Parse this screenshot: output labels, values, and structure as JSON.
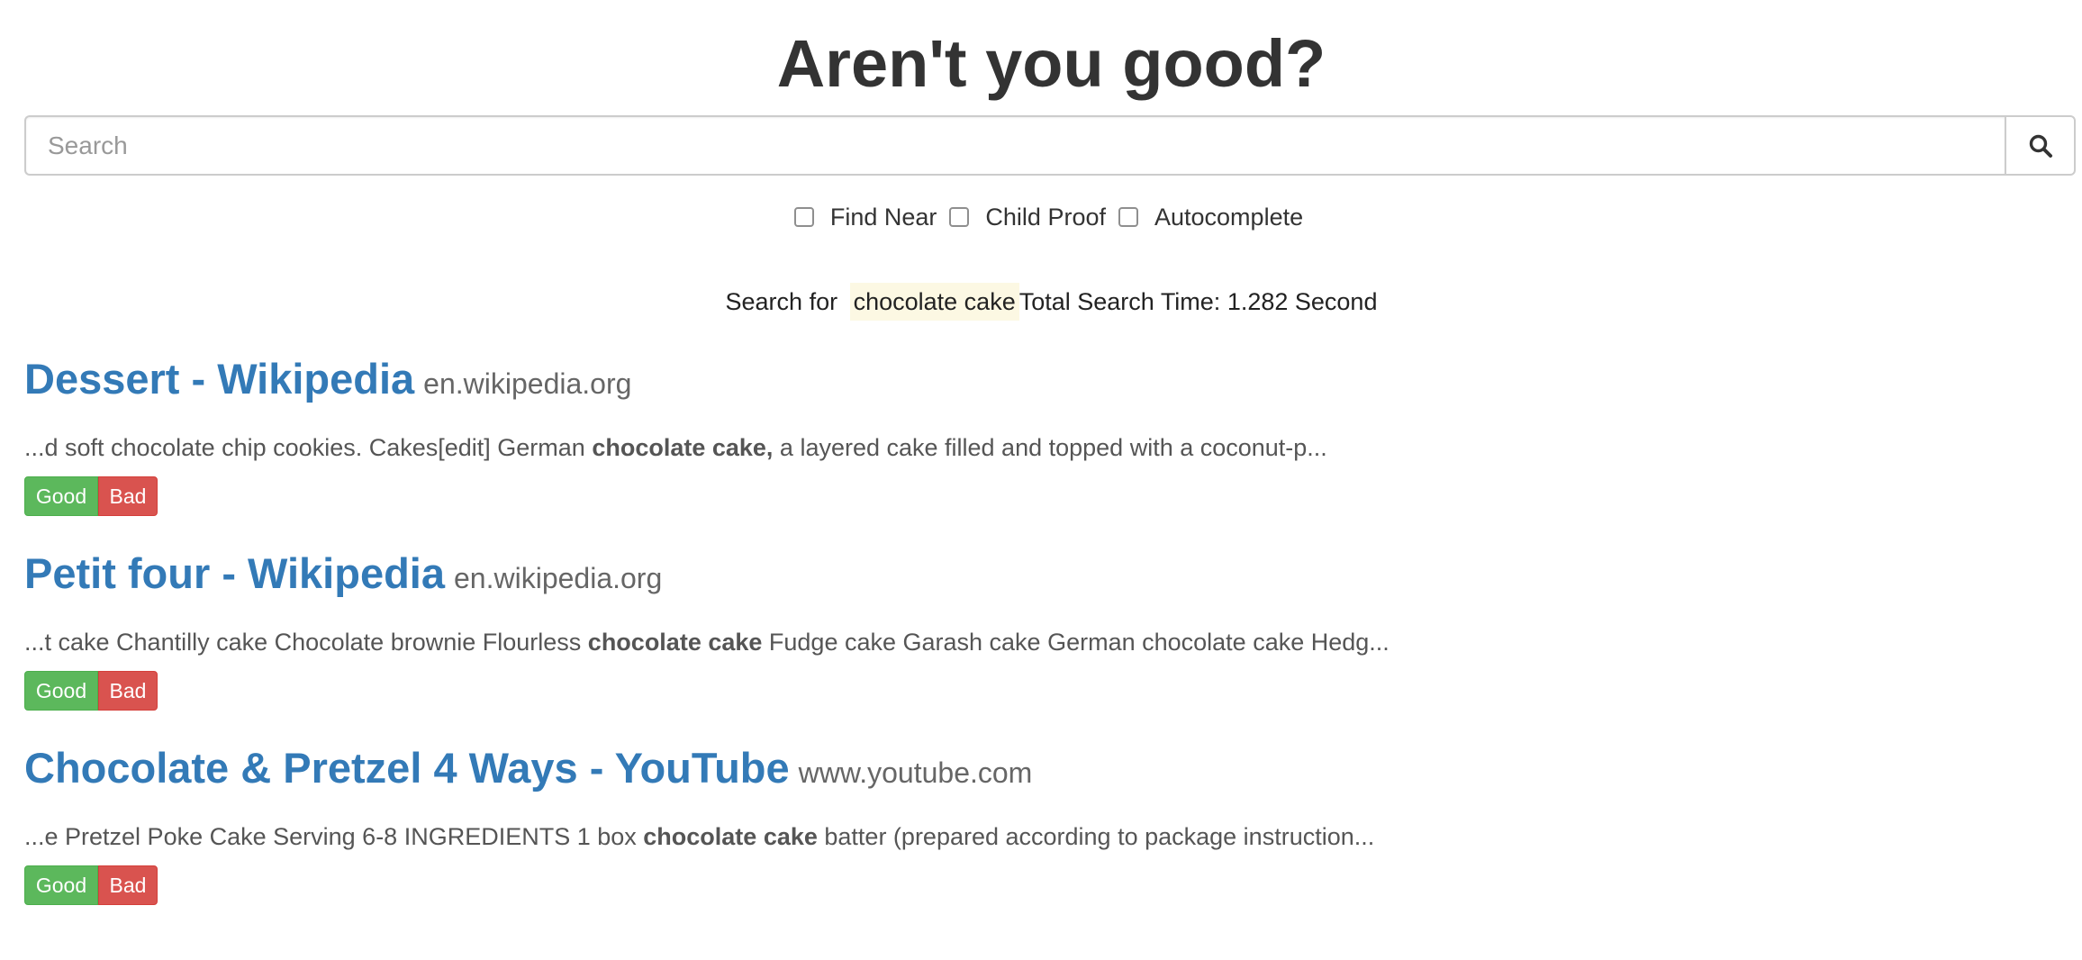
{
  "header": {
    "title": "Aren't you good?"
  },
  "search": {
    "placeholder": "Search",
    "value": "",
    "button_icon": "search-icon"
  },
  "options": [
    {
      "label": "Find Near",
      "checked": false
    },
    {
      "label": "Child Proof",
      "checked": false
    },
    {
      "label": "Autocomplete",
      "checked": false
    }
  ],
  "summary": {
    "prefix": "Search for",
    "query": "chocolate cake",
    "time_text": "Total Search Time: 1.282 Second"
  },
  "results": [
    {
      "title": "Dessert - Wikipedia",
      "domain": "en.wikipedia.org",
      "snippet_before": "...d soft chocolate chip cookies. Cakes[edit] German ",
      "snippet_bold": "chocolate cake,",
      "snippet_after": " a layered cake filled and topped with a coconut-p...",
      "good_label": "Good",
      "bad_label": "Bad"
    },
    {
      "title": "Petit four - Wikipedia",
      "domain": "en.wikipedia.org",
      "snippet_before": "...t cake Chantilly cake Chocolate brownie Flourless ",
      "snippet_bold": "chocolate cake",
      "snippet_after": " Fudge cake Garash cake German chocolate cake Hedg...",
      "good_label": "Good",
      "bad_label": "Bad"
    },
    {
      "title": "Chocolate & Pretzel 4 Ways - YouTube",
      "domain": "www.youtube.com",
      "snippet_before": "...e Pretzel Poke Cake Serving 6-8 INGREDIENTS 1 box ",
      "snippet_bold": "chocolate cake",
      "snippet_after": " batter (prepared according to package instruction...",
      "good_label": "Good",
      "bad_label": "Bad"
    }
  ],
  "colors": {
    "link": "#337ab7",
    "good": "#5cb85c",
    "bad": "#d9534f",
    "highlight": "#fcf8e3"
  }
}
